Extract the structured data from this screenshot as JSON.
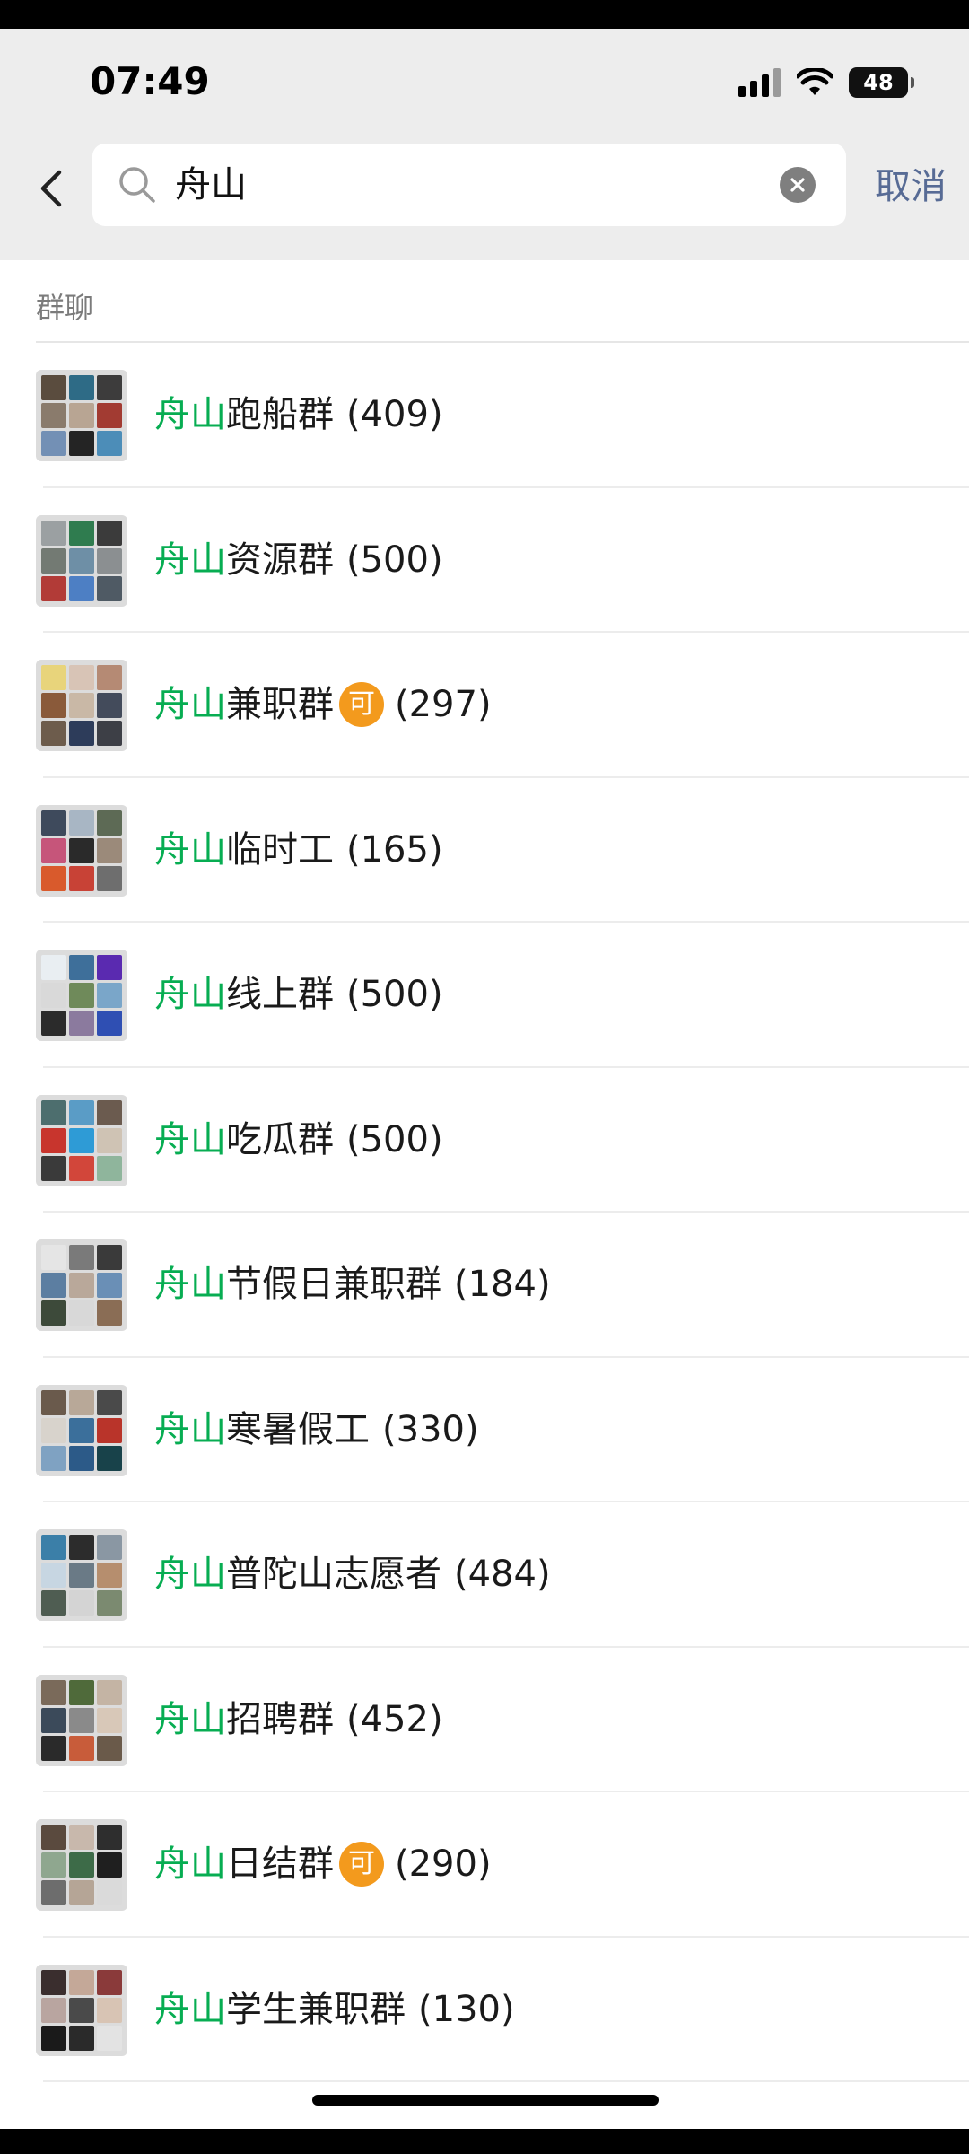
{
  "status_bar": {
    "time": "07:49",
    "battery": "48"
  },
  "search": {
    "query": "舟山",
    "cancel_label": "取消"
  },
  "section": {
    "title": "群聊"
  },
  "groups": [
    {
      "highlight": "舟山",
      "name_rest": "跑船群",
      "tag": "",
      "count": "(409)"
    },
    {
      "highlight": "舟山",
      "name_rest": "资源群",
      "tag": "",
      "count": "(500)"
    },
    {
      "highlight": "舟山",
      "name_rest": "兼职群",
      "tag": "可",
      "count": "(297)"
    },
    {
      "highlight": "舟山",
      "name_rest": "临时工",
      "tag": "",
      "count": "(165)"
    },
    {
      "highlight": "舟山",
      "name_rest": "线上群",
      "tag": "",
      "count": "(500)"
    },
    {
      "highlight": "舟山",
      "name_rest": "吃瓜群",
      "tag": "",
      "count": "(500)"
    },
    {
      "highlight": "舟山",
      "name_rest": "节假日兼职群",
      "tag": "",
      "count": "(184)"
    },
    {
      "highlight": "舟山",
      "name_rest": "寒暑假工",
      "tag": "",
      "count": "(330)"
    },
    {
      "highlight": "舟山",
      "name_rest": "普陀山志愿者",
      "tag": "",
      "count": "(484)"
    },
    {
      "highlight": "舟山",
      "name_rest": "招聘群",
      "tag": "",
      "count": "(452)"
    },
    {
      "highlight": "舟山",
      "name_rest": "日结群",
      "tag": "可",
      "count": "(290)"
    },
    {
      "highlight": "舟山",
      "name_rest": "学生兼职群",
      "tag": "",
      "count": "(130)"
    }
  ],
  "colors": {
    "highlight": "#07ad52",
    "cancel": "#576b95",
    "tag_bg": "#f39a1d",
    "header_bg": "#ededed"
  },
  "icons": {
    "back": "chevron-left-icon",
    "search": "search-icon",
    "clear": "clear-icon",
    "wifi": "wifi-icon",
    "signal": "signal-icon",
    "battery": "battery-icon"
  }
}
